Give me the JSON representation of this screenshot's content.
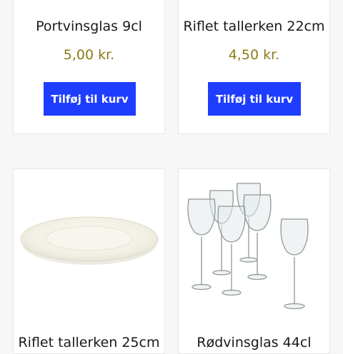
{
  "products": [
    {
      "name": "Portvinsglas 9cl",
      "price": "5,00 kr.",
      "button": "Tilføj til kurv"
    },
    {
      "name": "Riflet tallerken 22cm",
      "price": "4,50 kr.",
      "button": "Tilføj til kurv"
    },
    {
      "name": "Riflet tallerken 25cm",
      "image": "white-plate"
    },
    {
      "name": "Rødvinsglas 44cl",
      "image": "wine-glasses-set"
    }
  ],
  "colors": {
    "button": "#1f3dff",
    "price": "#8d7a16",
    "background": "#f7f7f7"
  }
}
